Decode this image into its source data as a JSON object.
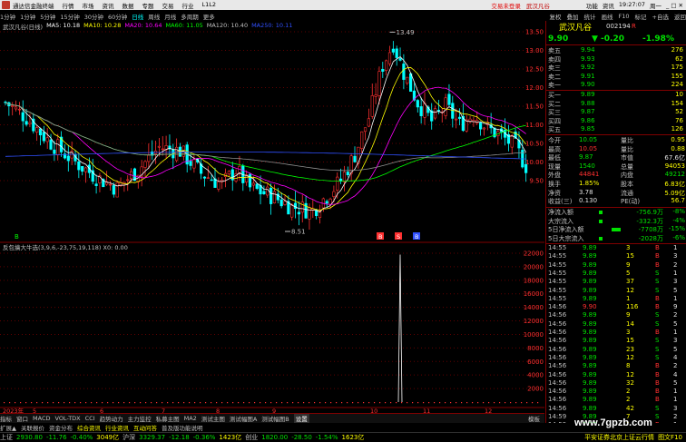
{
  "app": {
    "title": "通达信金融终端",
    "menu": [
      "行情",
      "市场",
      "资讯",
      "数据",
      "专题",
      "交易",
      "行业",
      "L1L2"
    ],
    "alert": "交易未登录",
    "stock_name_top": "武汉凡谷",
    "right_menu": [
      "功能",
      "资讯",
      "19:27:07",
      "周一"
    ]
  },
  "periods": [
    "1分钟",
    "1分钟",
    "5分钟",
    "15分钟",
    "30分钟",
    "60分钟",
    "日线",
    "周线",
    "月线",
    "多周期",
    "更多"
  ],
  "period_active_index": 6,
  "toolbar_right": [
    "复权",
    "叠加",
    "统计",
    "画线",
    "F10",
    "标记",
    "+自选",
    "返回"
  ],
  "chart": {
    "label": "武汉凡谷(日线)",
    "ma": [
      {
        "name": "MA5: 10.18",
        "color": "#ffffff"
      },
      {
        "name": "MA10: 10.28",
        "color": "#ffff00"
      },
      {
        "name": "MA20: 10.64",
        "color": "#ff00ff"
      },
      {
        "name": "MA60: 11.05",
        "color": "#00ff00"
      },
      {
        "name": "MA120: 10.40",
        "color": "#c0c0c0"
      },
      {
        "name": "MA250: 10.11",
        "color": "#3050ff"
      }
    ],
    "high_label": "13.49",
    "low_label": "8.51",
    "price_axis": [
      "13.50",
      "13.00",
      "12.50",
      "12.00",
      "11.50",
      "11.00",
      "10.50",
      "10.00",
      "9.50"
    ],
    "indicator_label": "反包擒大牛选(3,9,6,-23,75,19,118) X0: 0.00",
    "vol_axis": [
      "22000",
      "20000",
      "18000",
      "16000",
      "14000",
      "12000",
      "10000",
      "8000",
      "6000",
      "4000",
      "2000"
    ],
    "date_axis": [
      "2023年",
      "5",
      "6",
      "7",
      "8",
      "9",
      "10",
      "11",
      "12"
    ],
    "markers": [
      "B",
      "S",
      "B"
    ],
    "marker_left": "B"
  },
  "panel": {
    "name": "武汉凡谷",
    "code": "002194",
    "r_badge": "R",
    "price": "9.90",
    "change": "-0.20",
    "pct": "-1.98%",
    "sells": [
      {
        "label": "卖五",
        "price": "9.94",
        "vol": "276"
      },
      {
        "label": "卖四",
        "price": "9.93",
        "vol": "62"
      },
      {
        "label": "卖三",
        "price": "9.92",
        "vol": "175"
      },
      {
        "label": "卖二",
        "price": "9.91",
        "vol": "155"
      },
      {
        "label": "卖一",
        "price": "9.90",
        "vol": "224"
      }
    ],
    "buys": [
      {
        "label": "买一",
        "price": "9.89",
        "vol": "10"
      },
      {
        "label": "买二",
        "price": "9.88",
        "vol": "154"
      },
      {
        "label": "买三",
        "price": "9.87",
        "vol": "52"
      },
      {
        "label": "买四",
        "price": "9.86",
        "vol": "76"
      },
      {
        "label": "买五",
        "price": "9.85",
        "vol": "126"
      }
    ],
    "stats": [
      [
        "今开",
        "10.05",
        "量比",
        "0.95"
      ],
      [
        "最高",
        "10.05",
        "量比",
        "0.88"
      ],
      [
        "最低",
        "9.87",
        "市值",
        "67.6亿"
      ],
      [
        "现量",
        "1540",
        "总量",
        "94053"
      ],
      [
        "外盘",
        "44841",
        "内盘",
        "49212"
      ],
      [
        "换手",
        "1.85%",
        "股本",
        "6.83亿"
      ],
      [
        "净资",
        "3.78",
        "流通",
        "5.09亿"
      ],
      [
        "收益(三)",
        "0.130",
        "PE(动)",
        "56.7"
      ]
    ],
    "flows": [
      [
        "净流入额",
        "-756.9万",
        "-8%"
      ],
      [
        "大宗流入",
        "-332.3万",
        "-4%"
      ],
      [
        "5日净流入额",
        "-7708万",
        "-15%"
      ],
      [
        "5日大宗流入",
        "-2028万",
        "-6%"
      ]
    ],
    "ticks": [
      [
        "14:55",
        "9.89",
        "3",
        "B",
        "1"
      ],
      [
        "14:55",
        "9.89",
        "15",
        "B",
        "3"
      ],
      [
        "14:55",
        "9.89",
        "9",
        "B",
        "2"
      ],
      [
        "14:55",
        "9.89",
        "5",
        "S",
        "1"
      ],
      [
        "14:55",
        "9.89",
        "37",
        "S",
        "3"
      ],
      [
        "14:55",
        "9.89",
        "12",
        "S",
        "5"
      ],
      [
        "14:55",
        "9.89",
        "1",
        "B",
        "1"
      ],
      [
        "14:56",
        "9.90",
        "116",
        "B",
        "9"
      ],
      [
        "14:56",
        "9.89",
        "9",
        "S",
        "2"
      ],
      [
        "14:56",
        "9.89",
        "14",
        "S",
        "5"
      ],
      [
        "14:56",
        "9.89",
        "3",
        "B",
        "1"
      ],
      [
        "14:56",
        "9.89",
        "15",
        "S",
        "3"
      ],
      [
        "14:56",
        "9.89",
        "23",
        "S",
        "5"
      ],
      [
        "14:56",
        "9.89",
        "12",
        "S",
        "4"
      ],
      [
        "14:56",
        "9.89",
        "8",
        "B",
        "2"
      ],
      [
        "14:56",
        "9.89",
        "12",
        "B",
        "4"
      ],
      [
        "14:56",
        "9.89",
        "32",
        "B",
        "5"
      ],
      [
        "14:56",
        "9.89",
        "2",
        "B",
        "1"
      ],
      [
        "14:56",
        "9.89",
        "2",
        "B",
        "1"
      ],
      [
        "14:56",
        "9.89",
        "42",
        "S",
        "3"
      ],
      [
        "14:59",
        "9.89",
        "7",
        "S",
        "2"
      ],
      [
        "14:59",
        "9.89",
        "1",
        "B",
        "1"
      ]
    ]
  },
  "tabs": [
    "指标",
    "窗口",
    "MACD",
    "VOL-TDX",
    "CCI",
    "趋势动力",
    "主力监控",
    "私募主图",
    "MA2",
    "测试主图",
    "测试幅图A",
    "测试幅图B",
    "设置"
  ],
  "tabs_active_index": 12,
  "tab_right": "模板",
  "expand": [
    "扩展▲",
    "关联报价",
    "资金分布",
    "综合资讯",
    "行业资讯",
    "互动问答",
    "普及版功能说明"
  ],
  "expand_highlight": [
    3,
    4,
    5
  ],
  "status": [
    {
      "t": "上证",
      "c": "#c0c0c0"
    },
    {
      "t": "2930.80",
      "c": "#00e000"
    },
    {
      "t": "-11.76",
      "c": "#00e000"
    },
    {
      "t": "-0.40%",
      "c": "#00e000"
    },
    {
      "t": "3049亿",
      "c": "#ffff00"
    },
    {
      "t": "沪深",
      "c": "#c0c0c0"
    },
    {
      "t": "3329.37",
      "c": "#00e000"
    },
    {
      "t": "-12.18",
      "c": "#00e000"
    },
    {
      "t": "-0.36%",
      "c": "#00e000"
    },
    {
      "t": "1423亿",
      "c": "#ffff00"
    },
    {
      "t": "创业",
      "c": "#c0c0c0"
    },
    {
      "t": "1820.00",
      "c": "#00e000"
    },
    {
      "t": "-28.50",
      "c": "#00e000"
    },
    {
      "t": "-1.54%",
      "c": "#00e000"
    },
    {
      "t": "1623亿",
      "c": "#ffff00"
    }
  ],
  "status_right": "平安证券北京上证云行情",
  "status_far_right": "图文F10",
  "watermark": "www.7gpzb.com"
}
